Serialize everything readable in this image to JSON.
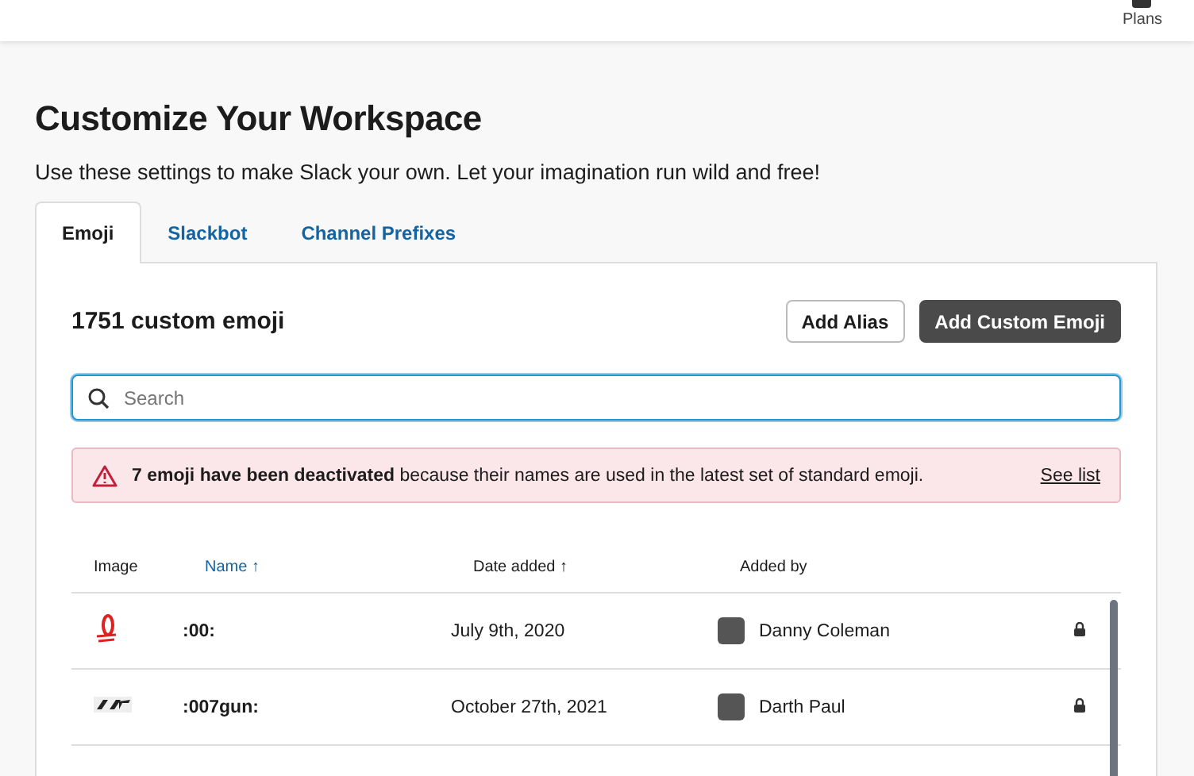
{
  "top_bar": {
    "plans_label": "Plans"
  },
  "title": "Customize Your Workspace",
  "subtitle": "Use these settings to make Slack your own. Let your imagination run wild and free!",
  "tabs": [
    {
      "label": "Emoji",
      "selected": true
    },
    {
      "label": "Slackbot",
      "selected": false
    },
    {
      "label": "Channel Prefixes",
      "selected": false
    }
  ],
  "panel": {
    "count": "1751 custom emoji",
    "buttons": [
      {
        "label": "Add Alias",
        "kind": "secondary"
      },
      {
        "label": "Add Custom Emoji",
        "kind": "primary"
      }
    ],
    "search": {
      "placeholder": "Search"
    },
    "alert": {
      "message": "**7 emoji have been deactivated** because their names are used in the latest set of standard emoji.",
      "link": "See list"
    },
    "table": {
      "columns": [
        {
          "label": "Image",
          "selected": false
        },
        {
          "label": "Name",
          "arrow": "↑",
          "selected": true
        },
        {
          "label": "Date added",
          "arrow": "↑",
          "selected": false
        },
        {
          "label": "Added by",
          "selected": false
        }
      ],
      "rows": [
        {
          "kind": "hundred",
          "name": ":00:",
          "date": "July 9th, 2020",
          "added_by": "Danny Coleman",
          "locked": true
        },
        {
          "kind": "logo",
          "name": ":007gun:",
          "date": "October 27th, 2021",
          "added_by": "Darth Paul",
          "locked": true
        },
        {
          "kind": "cut"
        }
      ]
    }
  }
}
